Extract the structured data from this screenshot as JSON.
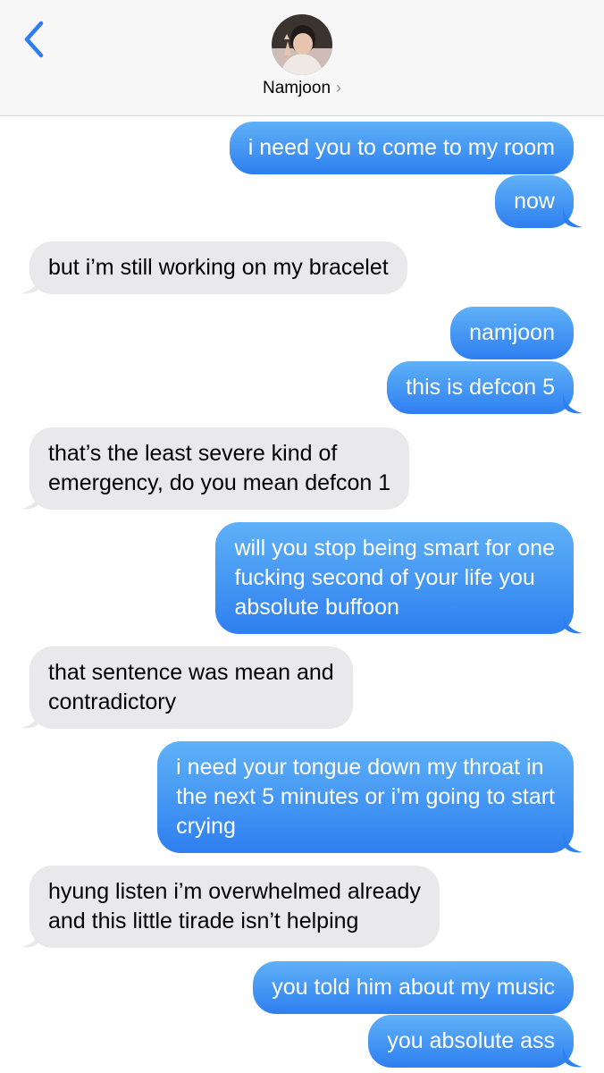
{
  "header": {
    "contact_name": "Namjoon",
    "chevron": "›",
    "back_icon": "chevron-left-icon",
    "accent": "#2f7cf6"
  },
  "messages": [
    {
      "side": "sent",
      "text": "i need you to come to my room"
    },
    {
      "side": "sent",
      "text": "now"
    },
    {
      "side": "received",
      "text": "but i’m still working on my bracelet"
    },
    {
      "side": "sent",
      "text": "namjoon"
    },
    {
      "side": "sent",
      "text": "this is defcon 5"
    },
    {
      "side": "received",
      "lines": [
        "that’s the least severe kind of",
        "emergency, do you mean defcon 1"
      ]
    },
    {
      "side": "sent",
      "lines": [
        "will you stop being smart for one",
        "fucking second of your life you",
        "absolute buffoon"
      ]
    },
    {
      "side": "received",
      "lines": [
        "that sentence was mean and",
        "contradictory"
      ]
    },
    {
      "side": "sent",
      "lines": [
        "i need your tongue down my throat in",
        "the next 5 minutes or i’m going to start",
        "crying"
      ]
    },
    {
      "side": "received",
      "lines": [
        "hyung listen i’m overwhelmed already",
        "and this little tirade isn’t helping"
      ]
    },
    {
      "side": "sent",
      "text": "you told him about my music"
    },
    {
      "side": "sent",
      "text": "you absolute ass"
    }
  ],
  "colors": {
    "sent_top": "#5fb1f7",
    "sent_bottom": "#2e7ff0",
    "received": "#e9e9eb"
  }
}
